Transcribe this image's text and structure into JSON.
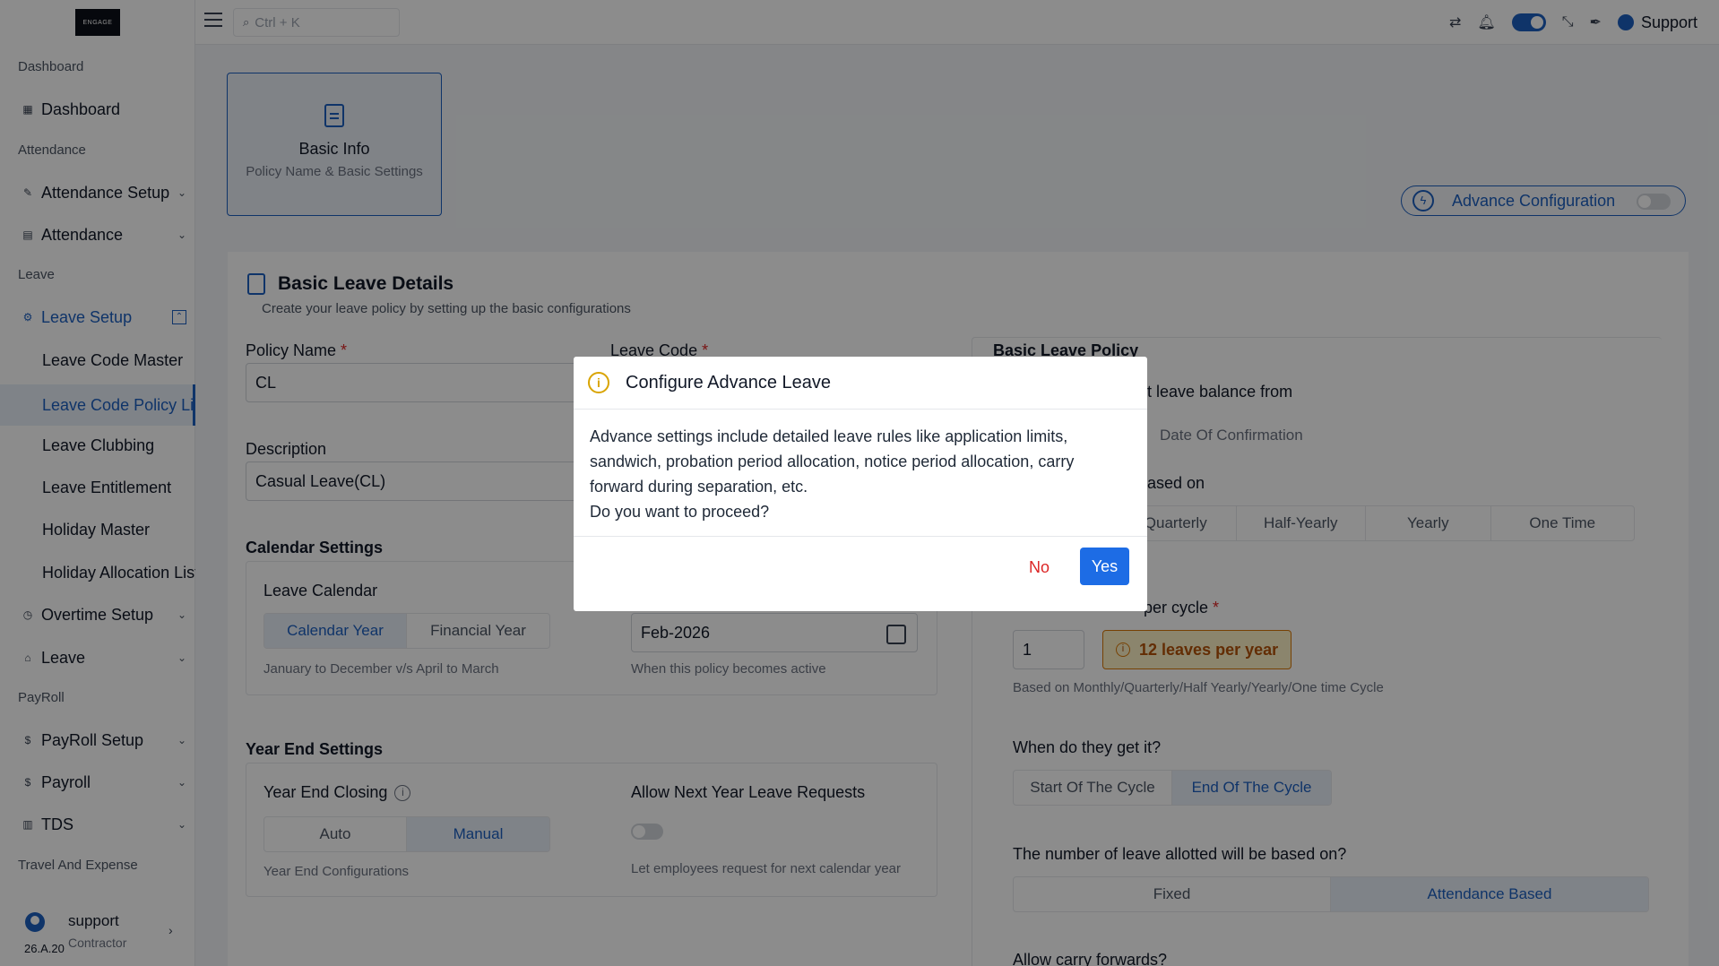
{
  "sidebar": {
    "logo_text": "ENGAGE",
    "sections": {
      "dashboard": "Dashboard",
      "attendance": "Attendance",
      "leave": "Leave",
      "payroll": "PayRoll",
      "travel": "Travel And Expense"
    },
    "items": {
      "dashboard": "Dashboard",
      "attendance_setup": "Attendance Setup",
      "attendance": "Attendance",
      "leave_setup": "Leave Setup",
      "leave_code_master": "Leave Code Master",
      "leave_code_policy": "Leave Code Policy List",
      "leave_clubbing": "Leave Clubbing",
      "leave_entitlement": "Leave Entitlement",
      "holiday_master": "Holiday Master",
      "holiday_allocation": "Holiday Allocation List",
      "overtime_setup": "Overtime Setup",
      "leave": "Leave",
      "payroll_setup": "PayRoll Setup",
      "payroll": "Payroll",
      "tds": "TDS"
    },
    "user": {
      "name": "support",
      "role": "Contractor",
      "version": "26.A.20"
    }
  },
  "topbar": {
    "search_placeholder": "Ctrl + K",
    "user_label": "Support"
  },
  "step": {
    "title": "Basic Info",
    "subtitle": "Policy Name & Basic Settings"
  },
  "advance_config": {
    "label": "Advance Configuration"
  },
  "form": {
    "title": "Basic Leave Details",
    "subtitle": "Create your leave policy by setting up the basic configurations",
    "policy_name_label": "Policy Name",
    "policy_name_value": "CL",
    "leave_code_label": "Leave Code",
    "description_label": "Description",
    "description_value": "Casual Leave(CL)",
    "required_mark": "*",
    "calendar_settings": "Calendar Settings",
    "leave_calendar": "Leave Calendar",
    "calendar_options": [
      "Calendar Year",
      "Financial Year"
    ],
    "calendar_hint": "January to December v/s April to March",
    "effective_value": "Feb-2026",
    "effective_hint": "When this policy becomes active",
    "year_end_settings": "Year End Settings",
    "year_end_closing": "Year End Closing",
    "year_end_options": [
      "Auto",
      "Manual"
    ],
    "year_end_hint": "Year End Configurations",
    "allow_next_year": "Allow Next Year Leave Requests",
    "allow_next_year_hint": "Let employees request for next calendar year"
  },
  "policy": {
    "title": "Basic Leave Policy",
    "balance_from_partial": "t leave balance from",
    "balance_option": "Date Of Confirmation",
    "based_on_partial": "ased on",
    "cycle_options": [
      "Quarterly",
      "Half-Yearly",
      "Yearly",
      "One Time"
    ],
    "per_cycle_partial": "per cycle",
    "per_cycle_value": "1",
    "per_year_badge": "12 leaves per year",
    "per_cycle_hint": "Based on Monthly/Quarterly/Half Yearly/Yearly/One time Cycle",
    "when_get": "When do they get it?",
    "when_options": [
      "Start Of The Cycle",
      "End Of The Cycle"
    ],
    "allotted_based": "The number of leave allotted will be based on?",
    "allotted_options": [
      "Fixed",
      "Attendance Based"
    ],
    "carry_forward": "Allow carry forwards?"
  },
  "modal": {
    "title": "Configure Advance Leave",
    "body_line1": "Advance settings include detailed leave rules like application limits, sandwich, probation period allocation, notice period allocation, carry forward during separation, etc.",
    "body_line2": "Do you want to proceed?",
    "no_label": "No",
    "yes_label": "Yes"
  }
}
